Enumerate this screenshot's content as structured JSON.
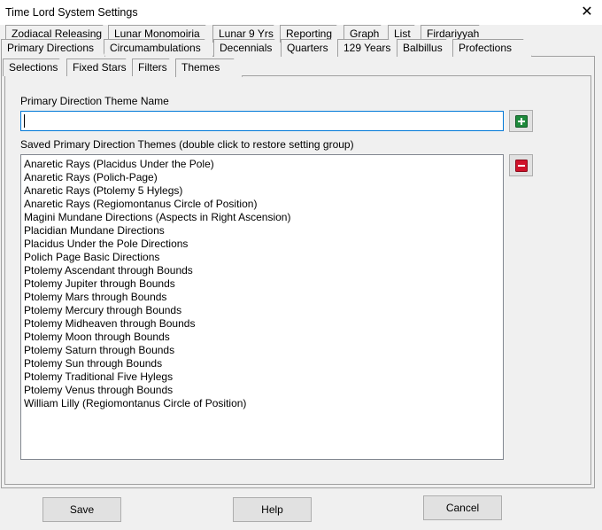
{
  "window": {
    "title": "Time Lord System Settings",
    "close_glyph": "✕"
  },
  "tabs_row1": [
    {
      "label": "Zodiacal Releasing"
    },
    {
      "label": "Lunar Monomoiria"
    },
    {
      "label": "Lunar 9 Yrs"
    },
    {
      "label": "Reporting"
    },
    {
      "label": "Graph"
    },
    {
      "label": "List"
    },
    {
      "label": "Firdariyyah"
    }
  ],
  "tabs_row2": [
    {
      "label": "Primary Directions",
      "active": true
    },
    {
      "label": "Circumambulations"
    },
    {
      "label": "Decennials"
    },
    {
      "label": "Quarters"
    },
    {
      "label": "129 Years"
    },
    {
      "label": "Balbillus"
    },
    {
      "label": "Profections"
    }
  ],
  "inner_tabs": [
    {
      "label": "Selections"
    },
    {
      "label": "Fixed Stars"
    },
    {
      "label": "Filters"
    },
    {
      "label": "Themes",
      "active": true
    }
  ],
  "theme_name": {
    "label": "Primary Direction Theme Name",
    "value": "",
    "add_icon": "plus-icon"
  },
  "saved_themes": {
    "label": "Saved Primary Direction Themes (double click to restore setting group)",
    "remove_icon": "minus-icon",
    "items": [
      "Anaretic Rays (Placidus Under the Pole)",
      "Anaretic Rays (Polich-Page)",
      "Anaretic Rays (Ptolemy 5 Hylegs)",
      "Anaretic Rays (Regiomontanus Circle of Position)",
      "Magini Mundane Directions (Aspects in Right Ascension)",
      "Placidian Mundane Directions",
      "Placidus Under the Pole Directions",
      "Polich Page Basic Directions",
      "Ptolemy Ascendant through Bounds",
      "Ptolemy Jupiter through Bounds",
      "Ptolemy Mars through Bounds",
      "Ptolemy Mercury through Bounds",
      "Ptolemy Midheaven through Bounds",
      "Ptolemy Moon through Bounds",
      "Ptolemy Saturn through Bounds",
      "Ptolemy Sun through Bounds",
      "Ptolemy Traditional Five Hylegs",
      "Ptolemy Venus through Bounds",
      "William Lilly (Regiomontanus Circle of Position)"
    ]
  },
  "buttons": {
    "save": "Save",
    "help": "Help",
    "cancel": "Cancel"
  },
  "colors": {
    "add_icon": "#1e8a3c",
    "remove_icon": "#d0122a",
    "input_focus_border": "#0078d7"
  }
}
